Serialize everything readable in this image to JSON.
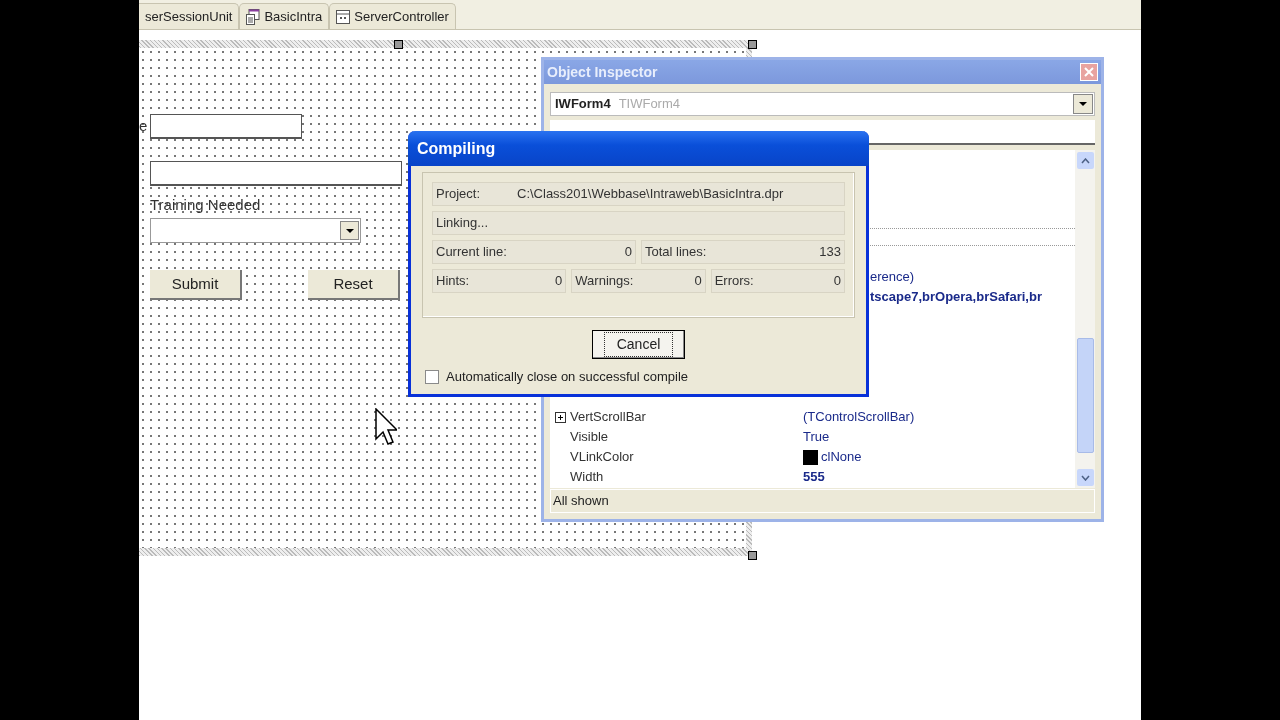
{
  "editor_tabs": [
    {
      "label": "serSessionUnit",
      "kind": "text"
    },
    {
      "label": "BasicIntra",
      "kind": "form"
    },
    {
      "label": "ServerController",
      "kind": "unit"
    }
  ],
  "designer": {
    "name_label": "e",
    "training_label": "Training Needed",
    "buttons": [
      "Submit",
      "Reset"
    ]
  },
  "object_inspector": {
    "title": "Object Inspector",
    "component_name": "IWForm4",
    "component_class": "TIWForm4",
    "partial_values": [
      {
        "text": "erence)",
        "bold": false
      },
      {
        "text": "tscape7,brOpera,brSafari,br",
        "bold": true
      }
    ],
    "properties": [
      {
        "name": "VertScrollBar",
        "value": "(TControlScrollBar)",
        "expandable": true,
        "modified": false
      },
      {
        "name": "Visible",
        "value": "True",
        "expandable": false,
        "modified": false
      },
      {
        "name": "VLinkColor",
        "value": "clNone",
        "expandable": false,
        "modified": false,
        "color": "#000000"
      },
      {
        "name": "Width",
        "value": "555",
        "expandable": false,
        "modified": true
      }
    ],
    "status": "All shown"
  },
  "compiling_dialog": {
    "title": "Compiling",
    "project_label": "Project:",
    "project": "C:\\Class201\\Webbase\\Intraweb\\BasicIntra.dpr",
    "status": "Linking...",
    "line_counts": [
      {
        "label": "Current line:",
        "value": "0"
      },
      {
        "label": "Total lines:",
        "value": "133"
      }
    ],
    "message_counts": [
      {
        "label": "Hints:",
        "value": "0"
      },
      {
        "label": "Warnings:",
        "value": "0"
      },
      {
        "label": "Errors:",
        "value": "0"
      }
    ],
    "cancel": "Cancel",
    "auto_close": {
      "label": "Automatically close on successful compile",
      "checked": false
    }
  }
}
